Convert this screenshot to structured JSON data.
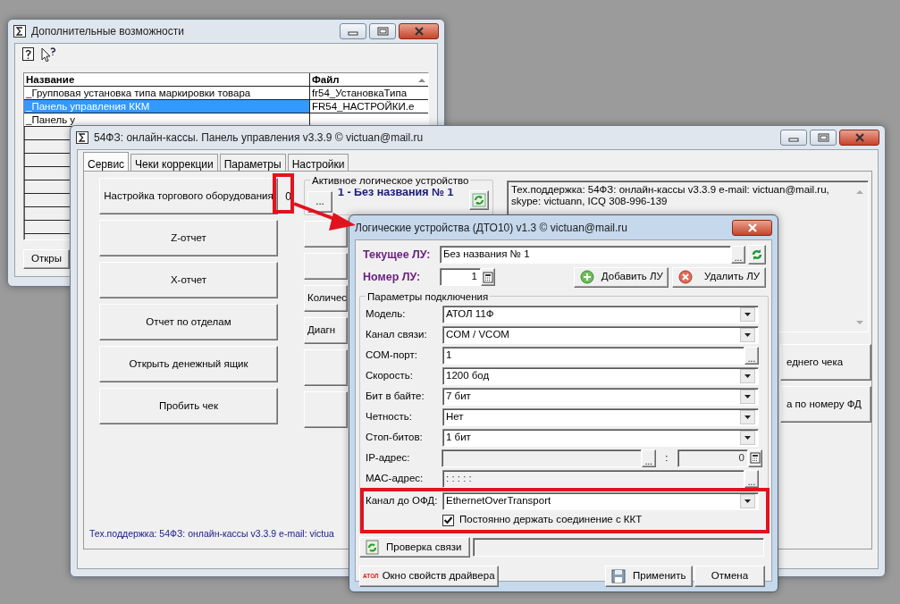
{
  "back_window": {
    "title": "Дополнительные возможности",
    "table": {
      "columns": [
        "Название",
        "Файл"
      ],
      "rows": [
        {
          "cells": [
            "_Групповая установка типа маркировки товара",
            "fr54_УстановкаТипа"
          ],
          "selected": false
        },
        {
          "cells": [
            "_Панель управления ККМ",
            "FR54_НАСТРОЙКИ.е"
          ],
          "selected": true
        },
        {
          "cells": [
            "_Панель у"
          ],
          "selected": false
        }
      ]
    },
    "open_button": "Откры"
  },
  "main_window": {
    "title": "54ФЗ: онлайн-кассы. Панель управления v3.3.9   © victuan@mail.ru",
    "tabs": [
      {
        "label": "Сервис",
        "selected": true
      },
      {
        "label": "Чеки коррекции",
        "selected": false
      },
      {
        "label": "Параметры",
        "selected": false
      },
      {
        "label": "Настройки",
        "selected": false
      }
    ],
    "left_buttons": [
      "Настройка торгового оборудования",
      "Z-отчет",
      "X-отчет",
      "Отчет по отделам",
      "Открыть денежный ящик",
      "Пробить чек"
    ],
    "device_counter": "0",
    "active_device": {
      "legend": "Активное логическое устройство",
      "browse": "...",
      "name": "1 - Без названия № 1"
    },
    "middle_buttons": [
      {
        "kind": "blank"
      },
      {
        "kind": "blank"
      },
      {
        "kind": "text",
        "label": "Количес"
      },
      {
        "kind": "text",
        "label": "Диагн"
      },
      {
        "kind": "blank"
      },
      {
        "kind": "blank"
      }
    ],
    "support_text": "Тех.поддержка: 54ФЗ: онлайн-кассы v3.3.9 e-mail: victuan@mail.ru, skype: victuann, ICQ 308-996-139",
    "right_buttons": [
      "еднего чека",
      "а по номеру ФД"
    ],
    "footer": "Тех.поддержка: 54ФЗ: онлайн-кассы v3.3.9 e-mail: victua"
  },
  "dialog": {
    "title": "Логические устройства (ДТО10) v1.3    © victuan@mail.ru",
    "current": {
      "label": "Текущее ЛУ:",
      "value": "Без названия № 1",
      "browse": "..."
    },
    "number": {
      "label": "Номер ЛУ:",
      "value": "1"
    },
    "add_button": "Добавить ЛУ",
    "delete_button": "Удалить ЛУ",
    "group_legend": "Параметры подключения",
    "fields": [
      {
        "kind": "select",
        "label": "Модель:",
        "value": "АТОЛ 11Ф",
        "disabled": false
      },
      {
        "kind": "select",
        "label": "Канал связи:",
        "value": "COM / VCOM",
        "disabled": false
      },
      {
        "kind": "browse",
        "label": "COM-порт:",
        "value": "1",
        "browse": "...",
        "disabled": false
      },
      {
        "kind": "select",
        "label": "Скорость:",
        "value": "1200 бод",
        "disabled": false
      },
      {
        "kind": "select",
        "label": "Бит в байте:",
        "value": "7 бит",
        "disabled": false
      },
      {
        "kind": "select",
        "label": "Четность:",
        "value": "Нет",
        "disabled": false
      },
      {
        "kind": "select",
        "label": "Стоп-битов:",
        "value": "1 бит",
        "disabled": false
      },
      {
        "kind": "ip",
        "label": "IP-адрес:",
        "browse": "...",
        "separator": ":",
        "port": "0",
        "disabled": true
      },
      {
        "kind": "browse",
        "label": "MAC-адрес:",
        "value": " :  :  :  :  :",
        "browse": "...",
        "disabled": true
      },
      {
        "kind": "select",
        "label": "Канал до ОФД:",
        "value": "EthernetOverTransport",
        "disabled": false
      }
    ],
    "keep_connection": {
      "label": "Постоянно держать соединение с ККТ",
      "checked": true
    },
    "check_button": "Проверка связи",
    "driver_logo": "АТОЛ",
    "driver_button": "Окно свойств драйвера",
    "apply_button": "Применить",
    "cancel_button": "Отмена"
  }
}
